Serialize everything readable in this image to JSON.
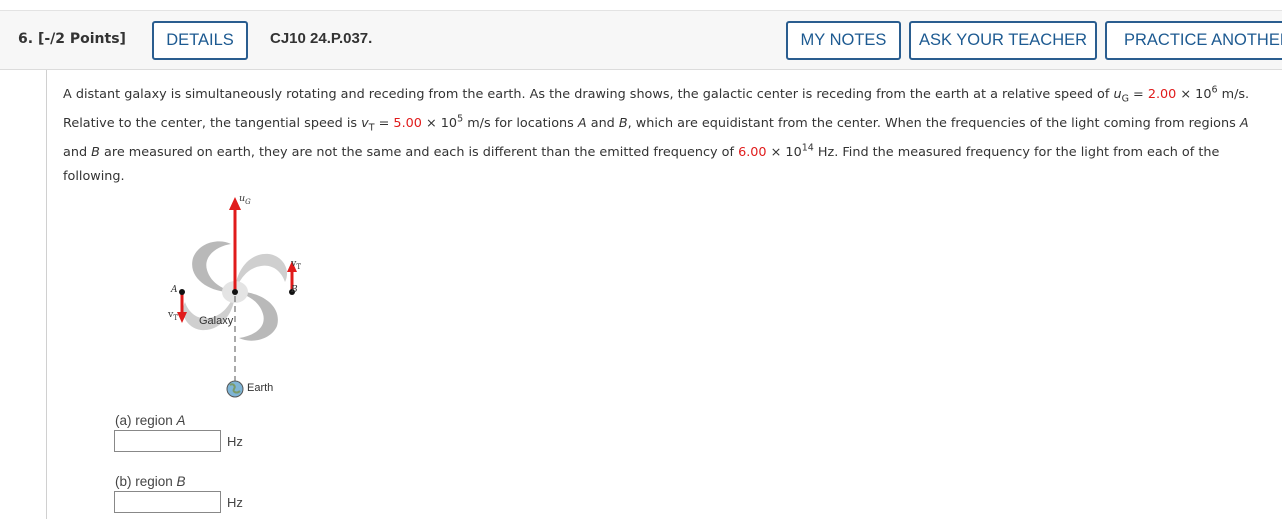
{
  "header": {
    "question_number": "6.",
    "points": "[-/2 Points]",
    "details_label": "DETAILS",
    "problem_code": "CJ10 24.P.037.",
    "my_notes_label": "MY NOTES",
    "ask_teacher_label": "ASK YOUR TEACHER",
    "practice_label": "PRACTICE ANOTHER"
  },
  "problem": {
    "p1": "A distant galaxy is simultaneously rotating and receding from the earth. As the drawing shows, the galactic center is receding from the earth at a relative speed of ",
    "uG_symbol": "u",
    "uG_sub": "G",
    "eq1": " = ",
    "uG_value": "2.00",
    "times1": " × 10",
    "uG_exp": "6",
    "p1_end": " m/s.",
    "p2": "Relative to the center, the tangential speed is ",
    "vT_symbol": "v",
    "vT_sub": "T",
    "eq2": " = ",
    "vT_value": "5.00",
    "times2": " × 10",
    "vT_exp": "5",
    "p2_mid": " m/s for locations ",
    "A": "A",
    "and": " and ",
    "B": "B",
    "p2_end": ", which are equidistant from the center. When the frequencies of the light coming from regions ",
    "A2": "A",
    "p3_and": "and ",
    "B2": "B",
    "p3": " are measured on earth, they are not the same and each is different than the emitted frequency of ",
    "freq_value": "6.00",
    "times3": " × 10",
    "freq_exp": "14",
    "p3_end": " Hz. Find the measured frequency for the light from each of the",
    "p4": "following."
  },
  "diagram": {
    "uG_label": "u",
    "uG_label_sub": "G",
    "vT_label": "v",
    "vT_label_sub": "T",
    "point_a": "A",
    "point_b": "B",
    "galaxy_label": "Galaxy",
    "earth_label": "Earth",
    "arrow_color": "#e01b1b"
  },
  "answers": {
    "a_label": "(a) region ",
    "a_region": "A",
    "a_unit": "Hz",
    "a_value": "",
    "b_label": "(b) region ",
    "b_region": "B",
    "b_unit": "Hz",
    "b_value": ""
  },
  "colors": {
    "button_border": "#2a5d8f",
    "button_text": "#1d5a91",
    "given_value": "#e01b1b"
  }
}
